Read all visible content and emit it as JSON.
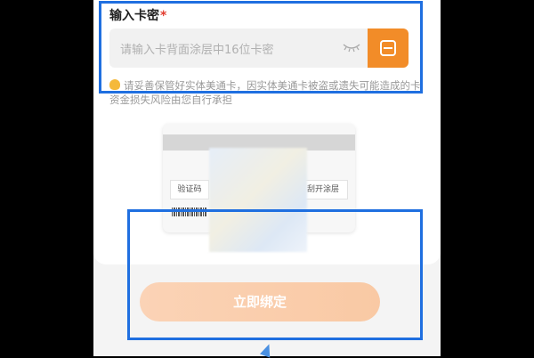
{
  "card_secret": {
    "label": "输入卡密",
    "required_mark": "*",
    "placeholder": "请输入卡背面涂层中16位卡密",
    "eye_icon": "eye-closed-icon",
    "scan_icon": "scan-icon"
  },
  "notice": {
    "text": "请妥善保管好实体美通卡，因实体美通卡被盗或遗失可能造成的卡资金损失风险由您自行承担"
  },
  "card_sample": {
    "code_label": "验证码",
    "scratch_label": "刮开涂层"
  },
  "bind_button": {
    "label": "立即绑定",
    "color": "#f9c9a4"
  },
  "colors": {
    "accent": "#f28c28",
    "highlight": "#1f6fe0",
    "required": "#e23b2e"
  }
}
